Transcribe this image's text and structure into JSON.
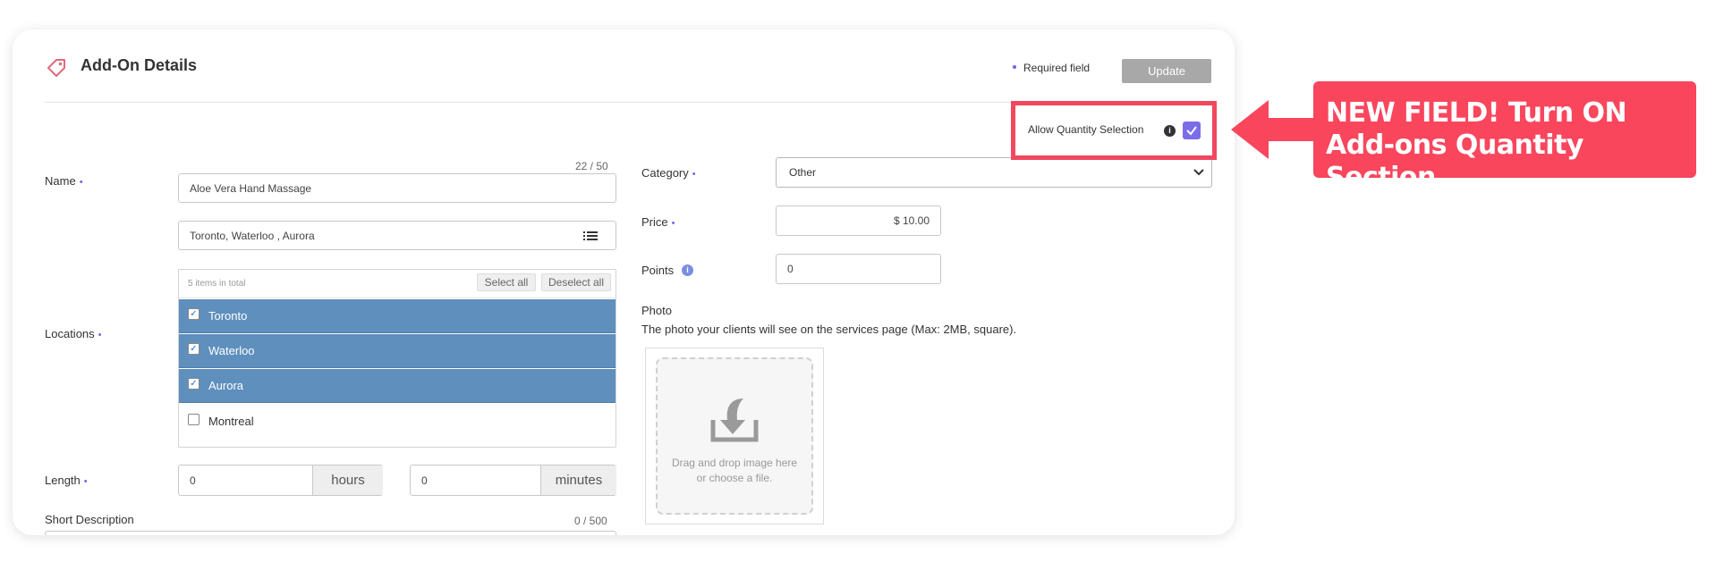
{
  "header": {
    "title": "Add-On Details",
    "required_note": "Required field",
    "update_label": "Update"
  },
  "quantity": {
    "label": "Allow Quantity Selection",
    "info_glyph": "i",
    "checked": true
  },
  "form": {
    "name": {
      "label": "Name",
      "counter": "22 / 50",
      "value": "Aloe Vera Hand Massage"
    },
    "locations": {
      "label": "Locations",
      "summary": "Toronto, Waterloo , Aurora",
      "count_text": "5 items in total",
      "select_all": "Select all",
      "deselect_all": "Deselect all",
      "items": [
        {
          "label": "Toronto",
          "checked": true
        },
        {
          "label": "Waterloo",
          "checked": true
        },
        {
          "label": "Aurora",
          "checked": true
        },
        {
          "label": "Montreal",
          "checked": false
        }
      ]
    },
    "length": {
      "label": "Length",
      "hours_value": "0",
      "hours_unit": "hours",
      "minutes_value": "0",
      "minutes_unit": "minutes"
    },
    "short_description": {
      "label": "Short Description",
      "counter": "0 / 500"
    },
    "category": {
      "label": "Category",
      "value": "Other"
    },
    "price": {
      "label": "Price",
      "value": "$ 10.00"
    },
    "points": {
      "label": "Points",
      "value": "0"
    },
    "photo": {
      "label": "Photo",
      "help": "The photo your clients will see on the services page (Max: 2MB, square).",
      "drop_line1": "Drag and drop image here",
      "drop_line2": "or choose a file."
    }
  },
  "callout": {
    "line1": "NEW FIELD! Turn ON",
    "line2": "Add-ons Quantity Section"
  },
  "colors": {
    "accent": "#7b5fe3",
    "callout": "#f9465d",
    "selected_row": "#5f8fbd",
    "checkbox": "#7b6de8"
  }
}
